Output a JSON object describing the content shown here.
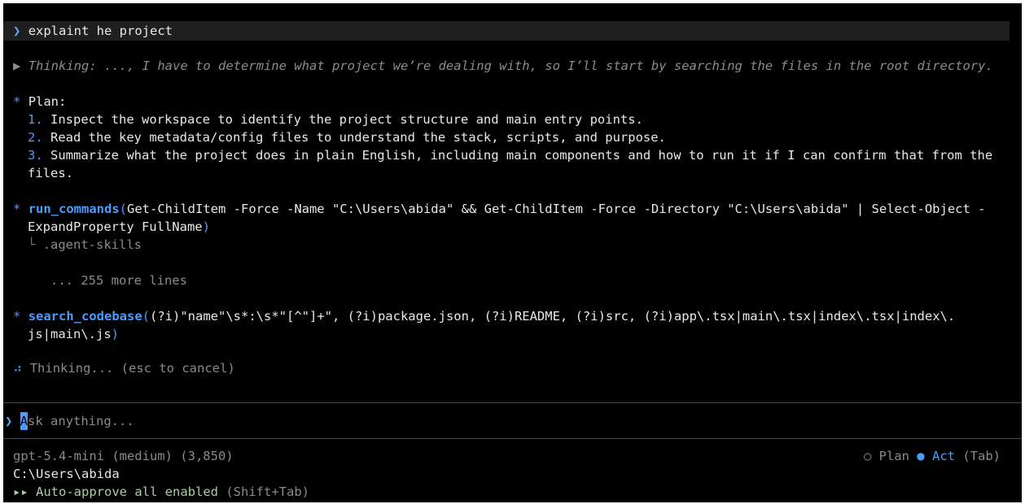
{
  "user_prompt": {
    "chevron": "❯",
    "text": "explaint he project"
  },
  "thinking_summary": {
    "marker": "▶",
    "text": "Thinking: ..., I have to determine what project we’re dealing with, so I’ll start by searching the files in the root directory."
  },
  "plan": {
    "marker": "*",
    "title": "Plan:",
    "steps": [
      {
        "num": "1.",
        "text": "Inspect the workspace to identify the project structure and main entry points."
      },
      {
        "num": "2.",
        "text": "Read the key metadata/config files to understand the stack, scripts, and purpose."
      },
      {
        "num": "3.",
        "text": "Summarize what the project does in plain English, including main components and how to run it if I can confirm that from the"
      }
    ],
    "step3_continuation": "files."
  },
  "run_commands": {
    "marker": "*",
    "name": "run_commands",
    "open_paren": "(",
    "args_line1": "Get-ChildItem -Force -Name \"C:\\Users\\abida\" && Get-ChildItem -Force -Directory \"C:\\Users\\abida\" | Select-Object -",
    "args_line2": "ExpandProperty FullName",
    "close_paren": ")",
    "output_prefix": "└",
    "output_line": ".agent-skills",
    "more_lines": "... 255 more lines"
  },
  "search_codebase": {
    "marker": "*",
    "name": "search_codebase",
    "open_paren": "(",
    "args_line1": "(?i)\"name\"\\s*:\\s*\"[^\"]+\", (?i)package.json, (?i)README, (?i)src, (?i)app\\.tsx|main\\.tsx|index\\.tsx|index\\.",
    "args_line2": "js|main\\.js",
    "close_paren": ")"
  },
  "thinking_status": {
    "spinner": "⠴",
    "text": "Thinking... (esc to cancel)"
  },
  "input": {
    "chevron": "❯",
    "cursor_char": "A",
    "placeholder_rest": "sk anything..."
  },
  "footer": {
    "model": "gpt-5.4-mini (medium) (3,850)",
    "path": "C:\\Users\\abida",
    "auto_approve_icon": "▸▸",
    "auto_approve_text": "Auto-approve all enabled",
    "auto_approve_hint": "(Shift+Tab)",
    "mode_plan_icon": "○",
    "mode_plan_label": "Plan",
    "mode_act_icon": "●",
    "mode_act_label": "Act",
    "mode_hint": "(Tab)"
  },
  "colors": {
    "background": "#000000",
    "accent": "#4b9cff",
    "dim_text": "#8a8a8a",
    "auto_approve": "#a7d1a0"
  }
}
